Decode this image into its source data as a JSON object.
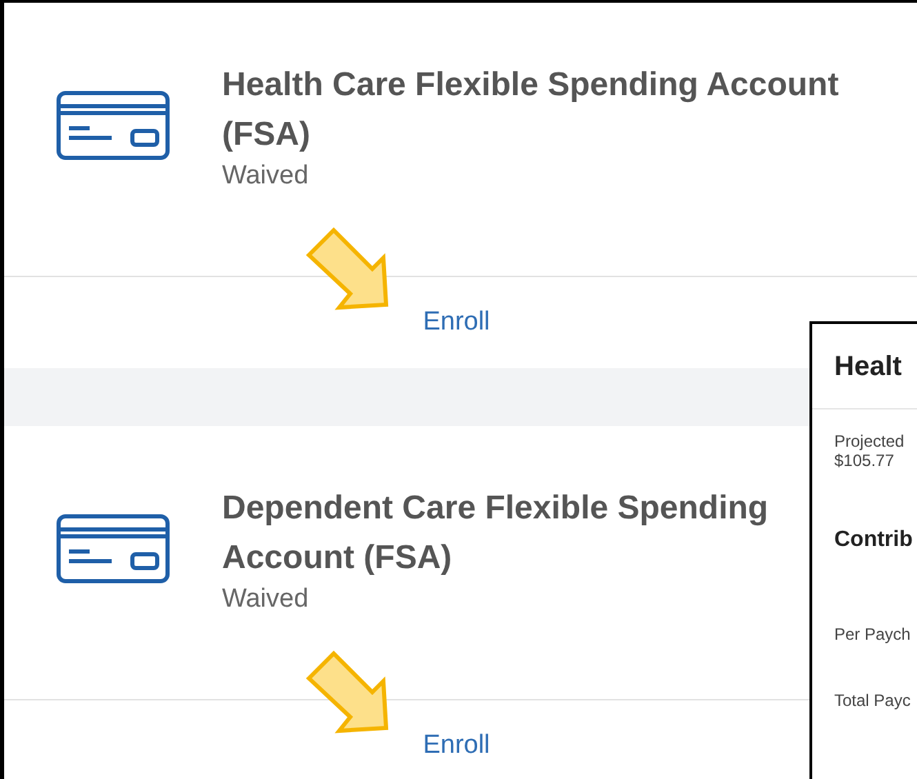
{
  "plans": [
    {
      "title": "Health Care Flexible Spending Account (FSA)",
      "status": "Waived",
      "action": "Enroll"
    },
    {
      "title": "Dependent Care Flexible Spending Account (FSA)",
      "status": "Waived",
      "action": "Enroll"
    }
  ],
  "detail_panel": {
    "title": "Healt",
    "fields": [
      {
        "kind": "label",
        "text": "Projected"
      },
      {
        "kind": "value",
        "text": "$105.77"
      },
      {
        "kind": "heading",
        "text": "Contrib"
      },
      {
        "kind": "label",
        "text": "Per Paych"
      },
      {
        "kind": "label",
        "text": "Total Payc"
      }
    ]
  }
}
